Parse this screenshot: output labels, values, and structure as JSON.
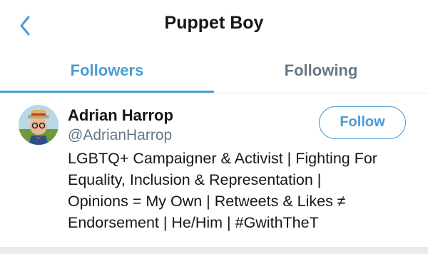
{
  "header": {
    "title": "Puppet Boy",
    "back_icon": "chevron-left-icon"
  },
  "tabs": [
    {
      "label": "Followers",
      "active": true
    },
    {
      "label": "Following",
      "active": false
    }
  ],
  "colors": {
    "accent": "#4a9bd6",
    "text_primary": "#14171a",
    "text_secondary": "#657786",
    "divider": "#e1e8ed"
  },
  "users": [
    {
      "name": "Adrian Harrop",
      "handle": "@AdrianHarrop",
      "follow_label": "Follow",
      "bio_lines": [
        "LGBTQ+ Campaigner & Activist | Fighting For",
        "Equality, Inclusion & Representation |",
        "Opinions = My Own | Retweets & Likes ≠",
        "Endorsement | He/Him | #GwithTheT"
      ]
    }
  ]
}
